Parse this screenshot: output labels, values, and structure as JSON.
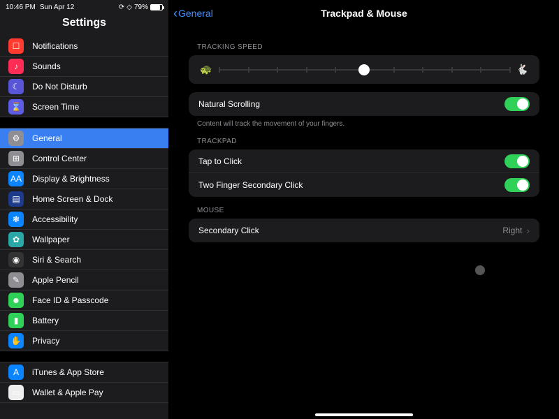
{
  "status": {
    "time": "10:46 PM",
    "date": "Sun Apr 12",
    "battery_pct": "79%"
  },
  "sidebar": {
    "title": "Settings",
    "items": [
      {
        "label": "Notifications",
        "icon_bg": "bg-red",
        "glyph": "☐",
        "name": "notifications"
      },
      {
        "label": "Sounds",
        "icon_bg": "bg-pink",
        "glyph": "♪",
        "name": "sounds"
      },
      {
        "label": "Do Not Disturb",
        "icon_bg": "bg-purple",
        "glyph": "☾",
        "name": "do-not-disturb"
      },
      {
        "label": "Screen Time",
        "icon_bg": "bg-indigo",
        "glyph": "⌛",
        "name": "screen-time"
      },
      {
        "gap": true
      },
      {
        "label": "General",
        "icon_bg": "bg-gray",
        "glyph": "⚙",
        "name": "general",
        "active": true
      },
      {
        "label": "Control Center",
        "icon_bg": "bg-gray",
        "glyph": "⊞",
        "name": "control-center"
      },
      {
        "label": "Display & Brightness",
        "icon_bg": "bg-blue",
        "glyph": "AA",
        "name": "display-brightness"
      },
      {
        "label": "Home Screen & Dock",
        "icon_bg": "bg-darkblue",
        "glyph": "▤",
        "name": "home-screen-dock"
      },
      {
        "label": "Accessibility",
        "icon_bg": "bg-blue",
        "glyph": "❃",
        "name": "accessibility"
      },
      {
        "label": "Wallpaper",
        "icon_bg": "bg-teal",
        "glyph": "✿",
        "name": "wallpaper"
      },
      {
        "label": "Siri & Search",
        "icon_bg": "bg-black",
        "glyph": "◉",
        "name": "siri-search"
      },
      {
        "label": "Apple Pencil",
        "icon_bg": "bg-gray",
        "glyph": "✎",
        "name": "apple-pencil"
      },
      {
        "label": "Face ID & Passcode",
        "icon_bg": "bg-green",
        "glyph": "☻",
        "name": "face-id-passcode"
      },
      {
        "label": "Battery",
        "icon_bg": "bg-green",
        "glyph": "▮",
        "name": "battery"
      },
      {
        "label": "Privacy",
        "icon_bg": "bg-lblue",
        "glyph": "✋",
        "name": "privacy"
      },
      {
        "gap": true
      },
      {
        "label": "iTunes & App Store",
        "icon_bg": "bg-blue",
        "glyph": "A",
        "name": "itunes-app-store"
      },
      {
        "label": "Wallet & Apple Pay",
        "icon_bg": "bg-white",
        "glyph": "▭",
        "name": "wallet-apple-pay"
      }
    ]
  },
  "detail": {
    "back": "General",
    "title": "Trackpad & Mouse",
    "sections": {
      "tracking_label": "TRACKING SPEED",
      "tracking_value": 0.5,
      "natural": {
        "label": "Natural Scrolling",
        "footnote": "Content will track the movement of your fingers.",
        "on": true
      },
      "trackpad_label": "TRACKPAD",
      "trackpad": [
        {
          "label": "Tap to Click",
          "on": true
        },
        {
          "label": "Two Finger Secondary Click",
          "on": true
        }
      ],
      "mouse_label": "MOUSE",
      "mouse": {
        "label": "Secondary Click",
        "value": "Right"
      }
    }
  }
}
